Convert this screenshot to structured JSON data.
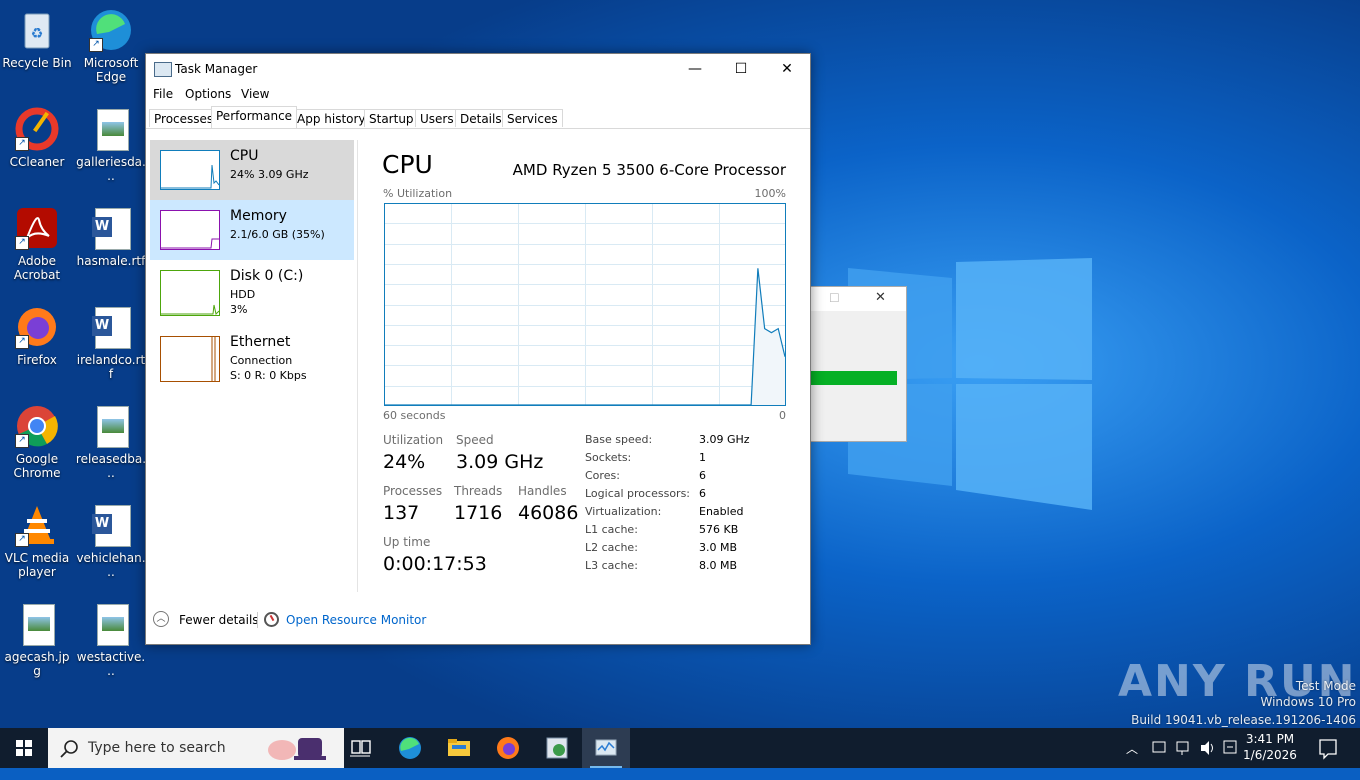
{
  "desktop": {
    "icons": [
      {
        "label": "Recycle Bin"
      },
      {
        "label": "Microsoft Edge"
      },
      {
        "label": "CCleaner"
      },
      {
        "label": "galleriesda..."
      },
      {
        "label": "Adobe Acrobat"
      },
      {
        "label": "hasmale.rtf"
      },
      {
        "label": "Firefox"
      },
      {
        "label": "irelandco.rtf"
      },
      {
        "label": "Google Chrome"
      },
      {
        "label": "releasedba..."
      },
      {
        "label": "VLC media player"
      },
      {
        "label": "vehiclehan..."
      },
      {
        "label": "agecash.jpg"
      },
      {
        "label": "westactive..."
      }
    ],
    "watermark": {
      "brand": "ANY RUN",
      "line1": "Test Mode",
      "line2": "Windows 10 Pro",
      "line3": "Build 19041.vb_release.191206-1406"
    },
    "bg_dialog_progress": 1.0
  },
  "window": {
    "title": "Task Manager",
    "minimize": "—",
    "maximize": "☐",
    "close": "✕"
  },
  "menu": [
    "File",
    "Options",
    "View"
  ],
  "tabs": [
    "Processes",
    "Performance",
    "App history",
    "Startup",
    "Users",
    "Details",
    "Services"
  ],
  "sidebar": [
    {
      "name": "CPU",
      "line1": "24%  3.09 GHz",
      "line2": "",
      "color": "#117dbb"
    },
    {
      "name": "Memory",
      "line1": "2.1/6.0 GB (35%)",
      "line2": "",
      "color": "#8b12ae"
    },
    {
      "name": "Disk 0 (C:)",
      "line1": "HDD",
      "line2": "3%",
      "color": "#4da60c"
    },
    {
      "name": "Ethernet",
      "line1": "Connection",
      "line2": "S: 0  R: 0 Kbps",
      "color": "#a74f01"
    }
  ],
  "cpu": {
    "title": "CPU",
    "processor": "AMD Ryzen 5 3500 6-Core Processor",
    "y_label": "% Utilization",
    "y_max_label": "100%",
    "x_label": "60 seconds",
    "x_min_label": "0",
    "graph_points": [
      0,
      0,
      0,
      0,
      0,
      0,
      0,
      0,
      0,
      0,
      0,
      0,
      0,
      0,
      0,
      0,
      0,
      0,
      0,
      0,
      0,
      0,
      0,
      0,
      0,
      0,
      0,
      0,
      0,
      0,
      0,
      0,
      0,
      0,
      0,
      0,
      0,
      0,
      0,
      0,
      0,
      0,
      0,
      0,
      0,
      0,
      0,
      0,
      0,
      0,
      0,
      0,
      0,
      0,
      0,
      68,
      38,
      36,
      38,
      24
    ],
    "stats": {
      "utilization_label": "Utilization",
      "utilization": "24%",
      "speed_label": "Speed",
      "speed": "3.09 GHz",
      "processes_label": "Processes",
      "processes": "137",
      "threads_label": "Threads",
      "threads": "1716",
      "handles_label": "Handles",
      "handles": "46086",
      "uptime_label": "Up time",
      "uptime": "0:00:17:53"
    },
    "specs": [
      {
        "label": "Base speed:",
        "value": "3.09 GHz"
      },
      {
        "label": "Sockets:",
        "value": "1"
      },
      {
        "label": "Cores:",
        "value": "6"
      },
      {
        "label": "Logical processors:",
        "value": "6"
      },
      {
        "label": "Virtualization:",
        "value": "Enabled"
      },
      {
        "label": "L1 cache:",
        "value": "576 KB"
      },
      {
        "label": "L2 cache:",
        "value": "3.0 MB"
      },
      {
        "label": "L3 cache:",
        "value": "8.0 MB"
      }
    ]
  },
  "footer": {
    "fewer_details": "Fewer details",
    "resource_monitor": "Open Resource Monitor"
  },
  "taskbar": {
    "search_placeholder": "Type here to search",
    "time": "3:41 PM",
    "date": "1/6/2026"
  }
}
